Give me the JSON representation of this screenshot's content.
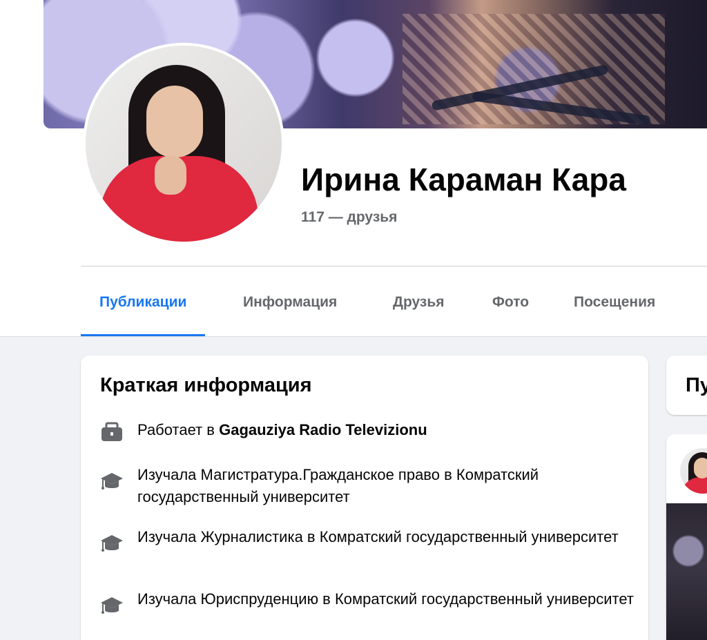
{
  "profile": {
    "name": "Ирина Караман Кара",
    "friends_text": "117 — друзья"
  },
  "tabs": [
    {
      "label": "Публикации",
      "active": true
    },
    {
      "label": "Информация",
      "active": false
    },
    {
      "label": "Друзья",
      "active": false
    },
    {
      "label": "Фото",
      "active": false
    },
    {
      "label": "Посещения",
      "active": false
    }
  ],
  "intro": {
    "title": "Краткая информация",
    "items": [
      {
        "icon": "briefcase-icon",
        "prefix": "Работает в ",
        "bold": "Gagauziya Radio Televizionu"
      },
      {
        "icon": "graduation-cap-icon",
        "text": "Изучала Магистратура.Гражданское право в Комратский государственный университет"
      },
      {
        "icon": "graduation-cap-icon",
        "text": "Изучала Журналистика в Комратский государственный университет"
      },
      {
        "icon": "graduation-cap-icon",
        "text": "Изучала Юриспруденцию в Комратский государственный университет"
      }
    ]
  },
  "side": {
    "posts_title": "Пу"
  },
  "colors": {
    "accent": "#1877f2",
    "text_primary": "#050505",
    "text_secondary": "#65676b",
    "background": "#f0f2f5",
    "icon": "#65676b"
  }
}
